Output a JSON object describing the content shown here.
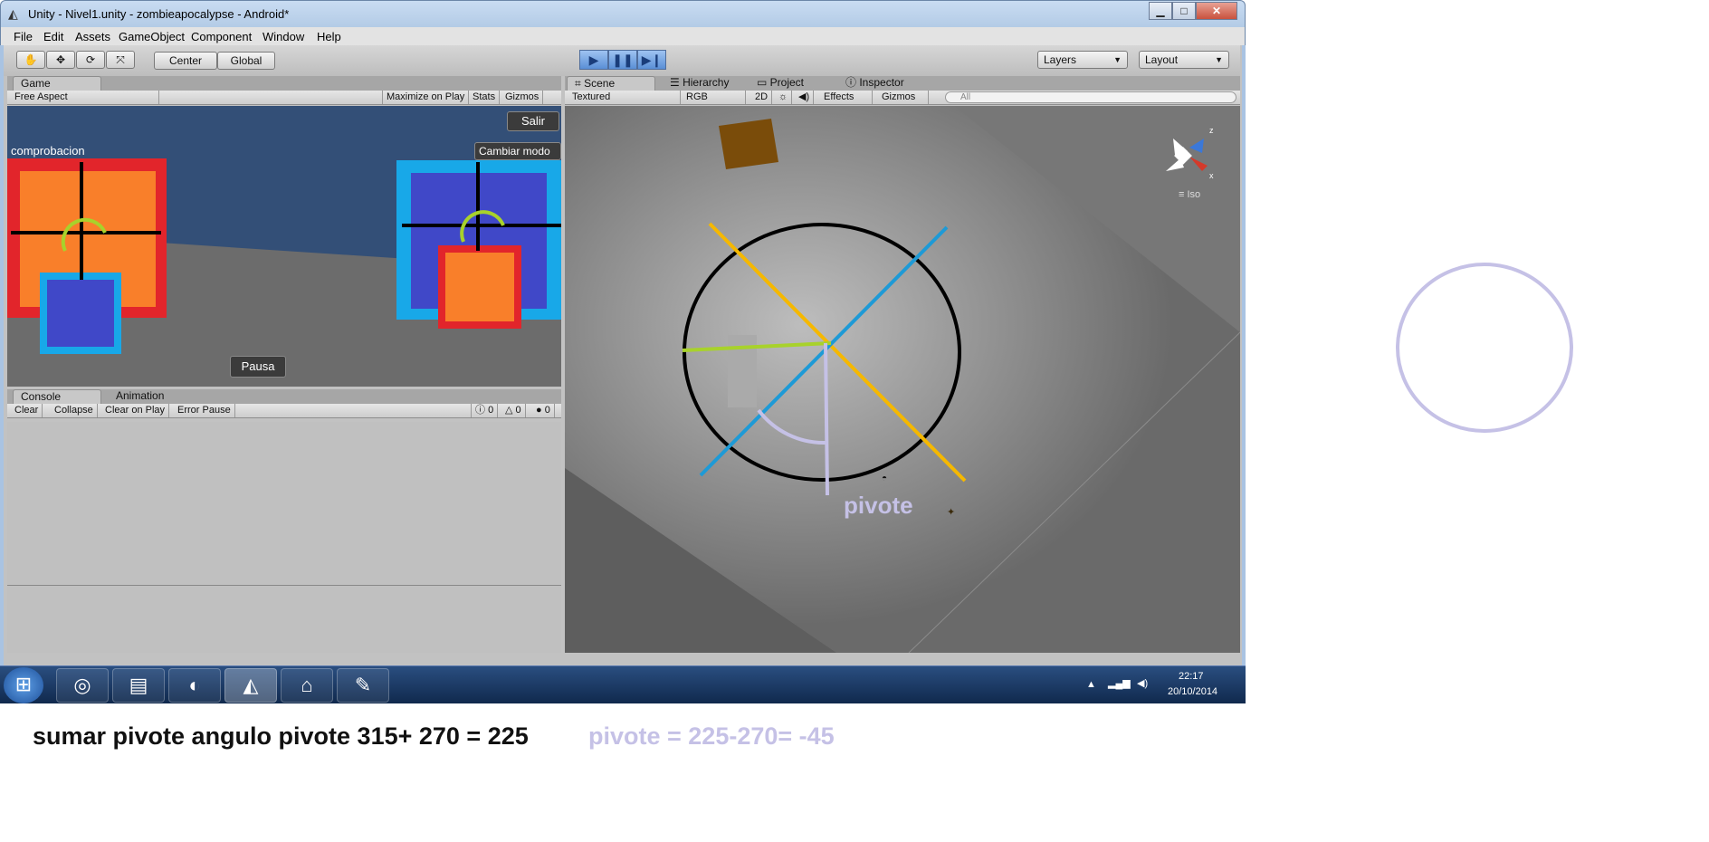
{
  "window": {
    "title": "Unity - Nivel1.unity - zombieapocalypse - Android*",
    "minimize": "▁",
    "maximize": "□",
    "close": "✕"
  },
  "menu": [
    "File",
    "Edit",
    "Assets",
    "GameObject",
    "Component",
    "Window",
    "Help"
  ],
  "toolbar": {
    "tools": [
      "hand-icon",
      "move-icon",
      "rotate-icon",
      "scale-icon"
    ],
    "pivot_mode": "Center",
    "pivot_rotation": "Global",
    "layers": "Layers",
    "layout": "Layout"
  },
  "game_panel": {
    "tab": "Game",
    "aspect": "Free Aspect",
    "maximize_on_play": "Maximize on Play",
    "stats": "Stats",
    "gizmos": "Gizmos",
    "label_comprobacion": "comprobacion",
    "btn_salir": "Salir",
    "btn_cambiar": "Cambiar modo",
    "btn_pausa": "Pausa"
  },
  "console_panel": {
    "tabs": [
      "Console",
      "Animation"
    ],
    "clear": "Clear",
    "collapse": "Collapse",
    "clear_on_play": "Clear on Play",
    "error_pause": "Error Pause",
    "counts": {
      "info": "0",
      "warn": "0",
      "error": "0"
    }
  },
  "scene_panel": {
    "tabs": [
      "Scene",
      "Hierarchy",
      "Project",
      "Inspector"
    ],
    "render_mode": "Textured",
    "color_mode": "RGB",
    "mode_2d": "2D",
    "effects": "Effects",
    "gizmos": "Gizmos",
    "search_placeholder": "All",
    "iso_label": "Iso",
    "pivot_label": "pivote"
  },
  "taskbar": {
    "time": "22:17",
    "date": "20/10/2014"
  },
  "annotations": {
    "left": "sumar pivote angulo pivote 315+ 270 = 225",
    "right": "pivote = 225-270= -45"
  },
  "colors": {
    "yellow_line": "#f5b800",
    "blue_line": "#1e9ad6",
    "green_line": "#a8d22b",
    "lavender": "#c5c1e6",
    "red": "#e2252b",
    "orange": "#f97f2a",
    "purple_blue": "#4048c8",
    "cyan": "#18a8e8"
  }
}
